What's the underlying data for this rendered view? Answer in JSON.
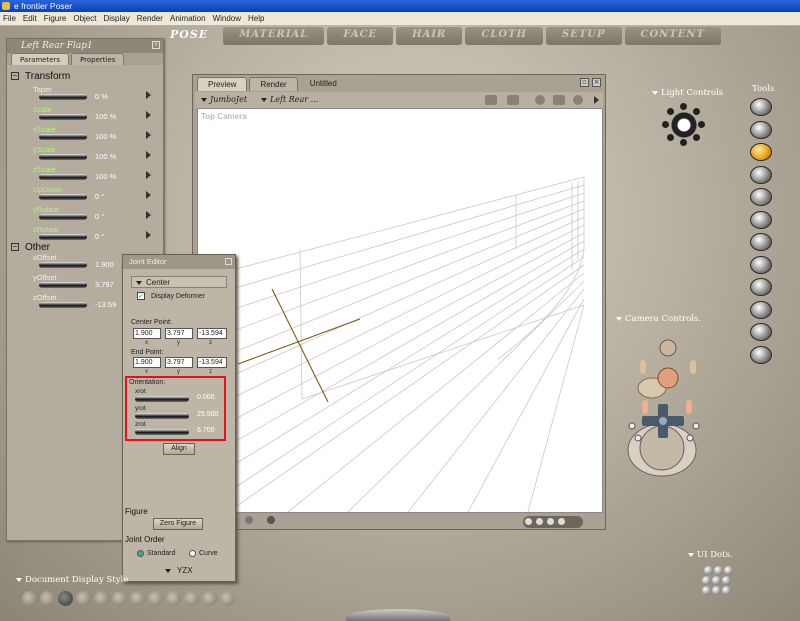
{
  "window": {
    "title": "e frontier Poser"
  },
  "menu": [
    "File",
    "Edit",
    "Figure",
    "Object",
    "Display",
    "Render",
    "Animation",
    "Window",
    "Help"
  ],
  "rooms": [
    "POSE",
    "MATERIAL",
    "FACE",
    "HAIR",
    "CLOTH",
    "SETUP",
    "CONTENT"
  ],
  "params_panel": {
    "title": "Left Rear Flap1",
    "close_glyph": "×",
    "tabs": [
      "Parameters",
      "Properties"
    ],
    "sections": {
      "transform": "Transform",
      "other": "Other"
    },
    "transform": [
      {
        "label": "Taper",
        "value": "0 %"
      },
      {
        "label": "Scale",
        "value": "100 %"
      },
      {
        "label": "xScale",
        "value": "100 %"
      },
      {
        "label": "yScale",
        "value": "100 %"
      },
      {
        "label": "zScale",
        "value": "100 %"
      },
      {
        "label": "UpDown",
        "value": "0 °"
      },
      {
        "label": "yRotate",
        "value": "0 °"
      },
      {
        "label": "zRotate",
        "value": "0 °"
      }
    ],
    "other": [
      {
        "label": "xOffset",
        "value": "1.900"
      },
      {
        "label": "yOffset",
        "value": "3.797"
      },
      {
        "label": "zOffset",
        "value": "-13.59"
      }
    ]
  },
  "preview": {
    "tabs": [
      "Preview",
      "Render",
      "Untitled"
    ],
    "figure_select": "JumboJet",
    "actor_select": "Left Rear ...",
    "camera_label": "Top Camera"
  },
  "joint_editor": {
    "title": "Joint Editor",
    "joint_type": "Center",
    "display_deformer_label": "Display Deformer",
    "center_point_label": "Center Point:",
    "center_point": {
      "x": "1.900",
      "y": "3.797",
      "z": "-13.594"
    },
    "end_point_label": "End Point:",
    "end_point": {
      "x": "1.900",
      "y": "3.797",
      "z": "-13.594"
    },
    "axis_labels": [
      "x",
      "y",
      "z"
    ],
    "orientation_label": "Orientation:",
    "orientation": [
      {
        "label": "xrot",
        "value": "0.000"
      },
      {
        "label": "yrot",
        "value": "25.500"
      },
      {
        "label": "zrot",
        "value": "6.700"
      }
    ],
    "align_button": "Align",
    "figure_section": "Figure",
    "zero_figure_button": "Zero Figure",
    "joint_order_section": "Joint Order",
    "radio_standard": "Standard",
    "radio_curve": "Curve",
    "order": "YZX"
  },
  "right_panel": {
    "light_controls": "Light Controls",
    "tools_label": "Tools",
    "camera_controls": "Camera Controls.",
    "ui_dots": "UI Dots."
  },
  "doc_display_style": "Document Display Style",
  "colors": {
    "highlight_box": "#e8101a",
    "active_tool": "#e8a010",
    "title_bar": "#0a3fbf"
  }
}
